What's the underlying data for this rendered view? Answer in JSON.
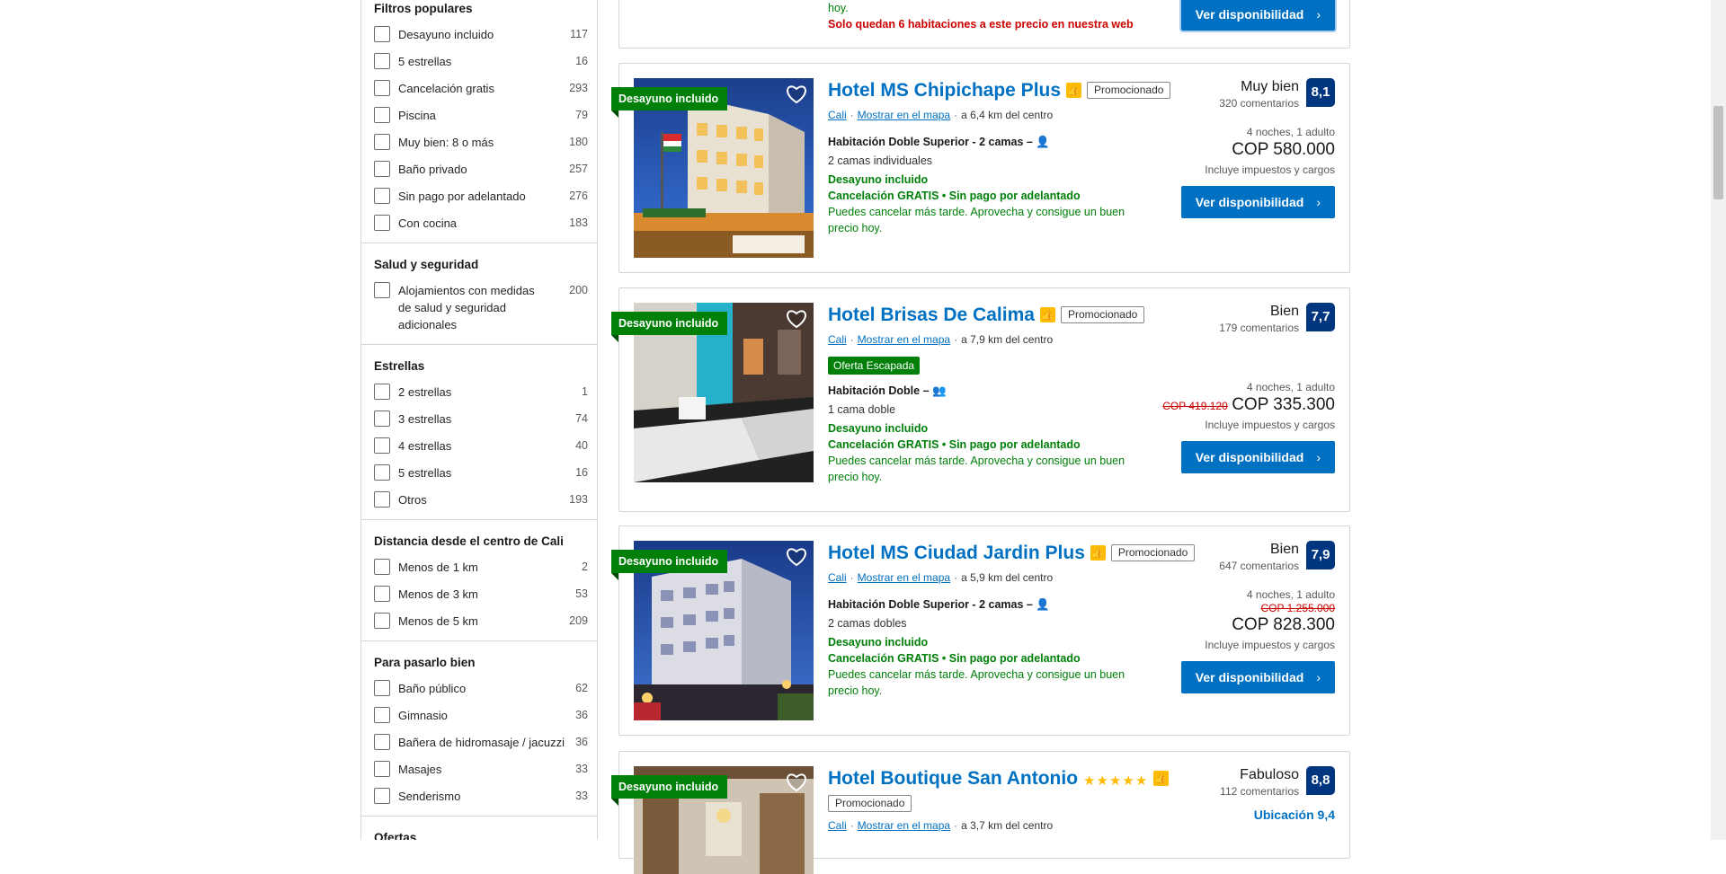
{
  "filters": {
    "popular": {
      "title": "Filtros populares",
      "items": [
        {
          "label": "Desayuno incluido",
          "count": "117"
        },
        {
          "label": "5 estrellas",
          "count": "16"
        },
        {
          "label": "Cancelación gratis",
          "count": "293"
        },
        {
          "label": "Piscina",
          "count": "79"
        },
        {
          "label": "Muy bien: 8 o más",
          "count": "180"
        },
        {
          "label": "Baño privado",
          "count": "257"
        },
        {
          "label": "Sin pago por adelantado",
          "count": "276"
        },
        {
          "label": "Con cocina",
          "count": "183"
        }
      ]
    },
    "health": {
      "title": "Salud y seguridad",
      "items": [
        {
          "label": "Alojamientos con medidas de salud y seguridad adicionales",
          "count": "200"
        }
      ]
    },
    "stars": {
      "title": "Estrellas",
      "items": [
        {
          "label": "2 estrellas",
          "count": "1"
        },
        {
          "label": "3 estrellas",
          "count": "74"
        },
        {
          "label": "4 estrellas",
          "count": "40"
        },
        {
          "label": "5 estrellas",
          "count": "16"
        },
        {
          "label": "Otros",
          "count": "193"
        }
      ]
    },
    "distance": {
      "title": "Distancia desde el centro de Cali",
      "items": [
        {
          "label": "Menos de 1 km",
          "count": "2"
        },
        {
          "label": "Menos de 3 km",
          "count": "53"
        },
        {
          "label": "Menos de 5 km",
          "count": "209"
        }
      ]
    },
    "fun": {
      "title": "Para pasarlo bien",
      "items": [
        {
          "label": "Baño público",
          "count": "62"
        },
        {
          "label": "Gimnasio",
          "count": "36"
        },
        {
          "label": "Bañera de hidromasaje / jacuzzi",
          "count": "36"
        },
        {
          "label": "Masajes",
          "count": "33"
        },
        {
          "label": "Senderismo",
          "count": "33"
        }
      ]
    },
    "offers": {
      "title": "Ofertas"
    }
  },
  "common": {
    "ribbon": "Desayuno incluido",
    "promo": "Promocionado",
    "city": "Cali",
    "map_link": "Mostrar en el mapa",
    "stay": "4 noches, 1 adulto",
    "taxes": "Incluye impuestos y cargos",
    "cta": "Ver disponibilidad",
    "breakfast": "Desayuno incluido",
    "cancel_free": "Cancelación GRATIS",
    "no_prepay": "Sin pago por adelantado",
    "cancel_later": "Puedes cancelar más tarde. Aprovecha y consigue un buen precio hoy."
  },
  "top_partial": {
    "line1": "hoy.",
    "scarcity": "Solo quedan 6 habitaciones a este precio en nuestra web"
  },
  "hotels": [
    {
      "name": "Hotel MS Chipichape Plus",
      "distance": "a 6,4 km del centro",
      "room": "Habitación Doble Superior - 2 camas",
      "beds": "2 camas individuales",
      "review_word": "Muy bien",
      "review_count": "320 comentarios",
      "score": "8,1",
      "price": "COP 580.000"
    },
    {
      "name": "Hotel Brisas De Calima",
      "distance": "a 7,9 km del centro",
      "offer": "Oferta Escapada",
      "room": "Habitación Doble",
      "beds": "1 cama doble",
      "review_word": "Bien",
      "review_count": "179 comentarios",
      "score": "7,7",
      "old_price": "COP 419.120",
      "price": "COP 335.300"
    },
    {
      "name": "Hotel MS Ciudad Jardin Plus",
      "distance": "a 5,9 km del centro",
      "room": "Habitación Doble Superior - 2 camas",
      "beds": "2 camas dobles",
      "review_word": "Bien",
      "review_count": "647 comentarios",
      "score": "7,9",
      "old_price": "COP 1.255.000",
      "price": "COP 828.300"
    },
    {
      "name": "Hotel Boutique San Antonio",
      "stars": "★★★★★",
      "distance": "a 3,7 km del centro",
      "review_word": "Fabuloso",
      "review_count": "112 comentarios",
      "score": "8,8",
      "location_score": "Ubicación 9,4"
    }
  ],
  "colors": {
    "brand_blue": "#0071c2",
    "score_navy": "#003580",
    "green": "#008009",
    "genius_yellow": "#febb02",
    "scarcity_red": "#cc0000"
  }
}
